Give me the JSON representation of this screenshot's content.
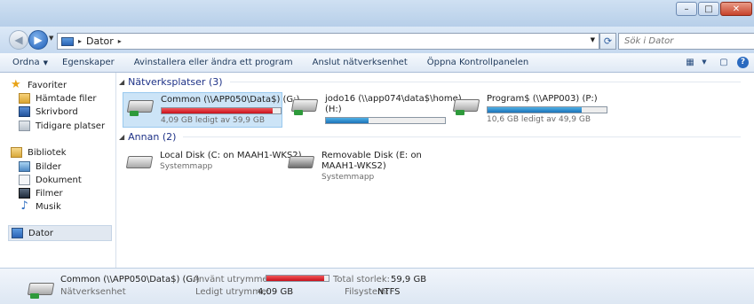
{
  "window": {
    "minimize": "–",
    "maximize": "□",
    "close": "✕"
  },
  "nav": {
    "back_icon": "◀",
    "forward_icon": "▶",
    "dropdown_icon": "▼",
    "computer_icon": "computer-icon"
  },
  "address": {
    "crumb": "Dator",
    "separator": "▸"
  },
  "search": {
    "placeholder": "Sök i Dator",
    "icon": "⌕"
  },
  "toolbar": {
    "organize": "Ordna",
    "properties": "Egenskaper",
    "uninstall": "Avinstallera eller ändra ett program",
    "map_drive": "Anslut nätverksenhet",
    "control_panel": "Öppna Kontrollpanelen",
    "view_icon": "▦",
    "preview_icon": "▢",
    "help_icon": "?"
  },
  "sidebar": {
    "favorites": "Favoriter",
    "downloads": "Hämtade filer",
    "desktop": "Skrivbord",
    "recent": "Tidigare platser",
    "libraries": "Bibliotek",
    "pictures": "Bilder",
    "documents": "Dokument",
    "videos": "Filmer",
    "music": "Musik",
    "computer": "Dator"
  },
  "groups": {
    "network": "Nätverksplatser (3)",
    "other": "Annan (2)"
  },
  "drives": {
    "common": {
      "name": "Common (\\\\APP050\\Data$) (G:)",
      "free": "4,09 GB ledigt av 59,9 GB",
      "used_fraction": 0.93
    },
    "jodo": {
      "name": "jodo16 (\\\\app074\\data$\\home)",
      "name2": "(H:)",
      "used_fraction": 0.36
    },
    "program": {
      "name": "Program$ (\\\\APP003) (P:)",
      "free": "10,6 GB ledigt av 49,9 GB",
      "used_fraction": 0.79
    },
    "local": {
      "name": "Local Disk (C: on MAAH1-WKS2)",
      "type": "Systemmapp"
    },
    "removable": {
      "name": "Removable Disk (E: on",
      "name2": "MAAH1-WKS2)",
      "type": "Systemmapp"
    }
  },
  "details": {
    "title": "Common (\\\\APP050\\Data$) (G:)",
    "type": "Nätverksenhet",
    "used_label": "Använt utrymme:",
    "total_label": "Total storlek:",
    "total_value": "59,9 GB",
    "free_label": "Ledigt utrymme:",
    "free_value": "4,09 GB",
    "fs_label": "Filsystem:",
    "fs_value": "NTFS",
    "used_fraction": 0.93
  },
  "colors": {
    "accent": "#1e3287",
    "selection": "#cce4f7",
    "bar_red": "#c8101b",
    "bar_blue": "#1c73b8"
  }
}
